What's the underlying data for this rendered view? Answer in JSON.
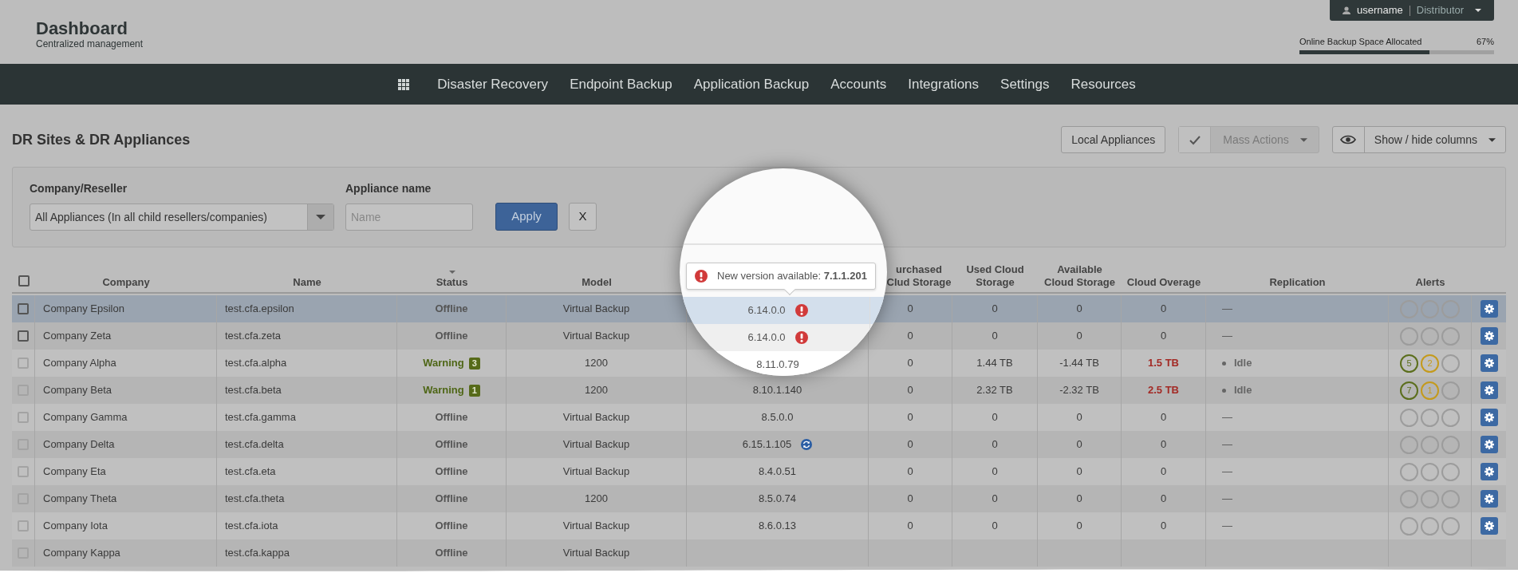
{
  "header": {
    "title": "Dashboard",
    "subtitle": "Centralized management",
    "user": {
      "name": "username",
      "role": "Distributor"
    },
    "storage": {
      "label": "Online Backup Space Allocated",
      "reading": "67%",
      "level": 0.67
    }
  },
  "nav": [
    "Disaster Recovery",
    "Endpoint Backup",
    "Application Backup",
    "Accounts",
    "Integrations",
    "Settings",
    "Resources"
  ],
  "section": {
    "title": "DR Sites & DR Appliances",
    "buttons": [
      {
        "kind": "plain",
        "label": "Local Appliances",
        "disabled": false
      },
      {
        "kind": "mass",
        "label": "Mass Actions",
        "disabled": true
      },
      {
        "kind": "columns",
        "label": "Show / hide columns",
        "disabled": false
      }
    ]
  },
  "filters": {
    "company_label": "Company/Reseller",
    "company_value": "All Appliances (In all child resellers/companies)",
    "name_label": "Appliance name",
    "name_placeholder": "Name",
    "apply": "Apply",
    "clear": "X"
  },
  "table": {
    "select_all_checked": false,
    "columns": [
      {
        "label": "Company",
        "sorted": false
      },
      {
        "label": "Name",
        "sorted": false
      },
      {
        "label": "Status",
        "sorted": true
      },
      {
        "label": "Model",
        "sorted": false
      },
      {
        "label": "urchased Clud Storage",
        "sorted": false
      },
      {
        "label": "Used Cloud Storage",
        "sorted": false
      },
      {
        "label": "Available Cloud Storage",
        "sorted": false
      },
      {
        "label": "Cloud Overage",
        "sorted": false
      },
      {
        "label": "Replication",
        "sorted": false
      },
      {
        "label": "Alerts",
        "sorted": false
      }
    ],
    "rows": [
      {
        "selected": true,
        "disabled": false,
        "company": "Company Epsilon",
        "name": "test.cfa.epsilon",
        "status": {
          "kind": "offline",
          "text": "Offline"
        },
        "model": "Virtual Backup",
        "purchased": "0",
        "used": "0",
        "available": "0",
        "overage": {
          "text": "0",
          "over": false
        },
        "replication": {
          "kind": "none",
          "text": "—"
        },
        "alerts": []
      },
      {
        "selected": false,
        "disabled": false,
        "company": "Company Zeta",
        "name": "test.cfa.zeta",
        "status": {
          "kind": "offline",
          "text": "Offline"
        },
        "model": "Virtual Backup",
        "purchased": "0",
        "used": "0",
        "available": "0",
        "overage": {
          "text": "0",
          "over": false
        },
        "replication": {
          "kind": "none",
          "text": "—"
        },
        "alerts": []
      },
      {
        "selected": false,
        "disabled": true,
        "company": "Company Alpha",
        "name": "test.cfa.alpha",
        "status": {
          "kind": "warning",
          "text": "Warning",
          "count": "3"
        },
        "model": "1200",
        "purchased": "0",
        "used": "1.44 TB",
        "available": "-1.44 TB",
        "overage": {
          "text": "1.5 TB",
          "over": true
        },
        "replication": {
          "kind": "idle",
          "text": "Idle"
        },
        "alerts": [
          {
            "text": "5",
            "color": "#5b6e1c"
          },
          {
            "text": "2",
            "color": "#c49a1c"
          }
        ]
      },
      {
        "selected": false,
        "disabled": true,
        "company": "Company Beta",
        "name": "test.cfa.beta",
        "status": {
          "kind": "warning",
          "text": "Warning",
          "count": "1"
        },
        "model": "1200",
        "version": {
          "text": "8.10.1.140",
          "update": false
        },
        "purchased": "0",
        "used": "2.32 TB",
        "available": "-2.32 TB",
        "overage": {
          "text": "2.5 TB",
          "over": true
        },
        "replication": {
          "kind": "idle",
          "text": "Idle"
        },
        "alerts": [
          {
            "text": "7",
            "color": "#5b6e1c"
          },
          {
            "text": "1",
            "color": "#c49a1c"
          }
        ]
      },
      {
        "selected": false,
        "disabled": true,
        "company": "Company Gamma",
        "name": "test.cfa.gamma",
        "status": {
          "kind": "offline",
          "text": "Offline"
        },
        "model": "Virtual Backup",
        "version": {
          "text": "8.5.0.0",
          "update": false
        },
        "purchased": "0",
        "used": "0",
        "available": "0",
        "overage": {
          "text": "0",
          "over": false
        },
        "replication": {
          "kind": "none",
          "text": "—"
        },
        "alerts": []
      },
      {
        "selected": false,
        "disabled": true,
        "company": "Company Delta",
        "name": "test.cfa.delta",
        "status": {
          "kind": "offline",
          "text": "Offline"
        },
        "model": "Virtual Backup",
        "version": {
          "text": "6.15.1.105",
          "update": true
        },
        "purchased": "0",
        "used": "0",
        "available": "0",
        "overage": {
          "text": "0",
          "over": false
        },
        "replication": {
          "kind": "none",
          "text": "—"
        },
        "alerts": []
      },
      {
        "selected": false,
        "disabled": true,
        "company": "Company Eta",
        "name": "test.cfa.eta",
        "status": {
          "kind": "offline",
          "text": "Offline"
        },
        "model": "Virtual Backup",
        "version": {
          "text": "8.4.0.51",
          "update": false
        },
        "purchased": "0",
        "used": "0",
        "available": "0",
        "overage": {
          "text": "0",
          "over": false
        },
        "replication": {
          "kind": "none",
          "text": "—"
        },
        "alerts": []
      },
      {
        "selected": false,
        "disabled": true,
        "company": "Company Theta",
        "name": "test.cfa.theta",
        "status": {
          "kind": "offline",
          "text": "Offline"
        },
        "model": "1200",
        "version": {
          "text": "8.5.0.74",
          "update": false
        },
        "purchased": "0",
        "used": "0",
        "available": "0",
        "overage": {
          "text": "0",
          "over": false
        },
        "replication": {
          "kind": "none",
          "text": "—"
        },
        "alerts": []
      },
      {
        "selected": false,
        "disabled": true,
        "company": "Company Iota",
        "name": "test.cfa.iota",
        "status": {
          "kind": "offline",
          "text": "Offline"
        },
        "model": "Virtual Backup",
        "version": {
          "text": "8.6.0.13",
          "update": false
        },
        "purchased": "0",
        "used": "0",
        "available": "0",
        "overage": {
          "text": "0",
          "over": false
        },
        "replication": {
          "kind": "none",
          "text": "—"
        },
        "alerts": []
      },
      {
        "selected": false,
        "disabled": true,
        "company": "Company Kappa",
        "name": "test.cfa.kappa",
        "status": {
          "kind": "offline",
          "text": "Offline"
        },
        "model": "Virtual Backup"
      }
    ]
  },
  "magnifier": {
    "tooltip": "New version available: **7.1.1.201**",
    "versions": [
      {
        "text": "6.14.0.0",
        "alert": true,
        "selected": true
      },
      {
        "text": "6.14.0.0",
        "alert": true,
        "selected": false
      },
      {
        "text": "8.11.0.79",
        "alert": false,
        "selected": false
      }
    ]
  }
}
